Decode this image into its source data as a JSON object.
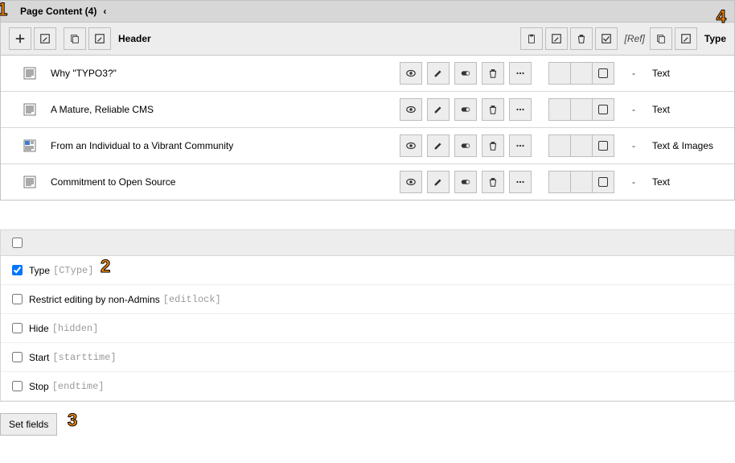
{
  "panel": {
    "title": "Page Content (4)",
    "collapse_glyph": "‹"
  },
  "columns": {
    "header": "Header",
    "ref": "[Ref]",
    "type": "Type"
  },
  "rows": [
    {
      "title": "Why \"TYPO3?\"",
      "type": "Text",
      "dash": "-",
      "icon": "text"
    },
    {
      "title": "A Mature, Reliable CMS",
      "type": "Text",
      "dash": "-",
      "icon": "text"
    },
    {
      "title": "From an Individual to a Vibrant Community",
      "type": "Text & Images",
      "dash": "-",
      "icon": "textpic"
    },
    {
      "title": "Commitment to Open Source",
      "type": "Text",
      "dash": "-",
      "icon": "text"
    }
  ],
  "fields": {
    "items": [
      {
        "label": "Type",
        "tech": "[CType]",
        "checked": true
      },
      {
        "label": "Restrict editing by non-Admins",
        "tech": "[editlock]",
        "checked": false
      },
      {
        "label": "Hide",
        "tech": "[hidden]",
        "checked": false
      },
      {
        "label": "Start",
        "tech": "[starttime]",
        "checked": false
      },
      {
        "label": "Stop",
        "tech": "[endtime]",
        "checked": false
      }
    ],
    "button": "Set fields"
  },
  "callouts": {
    "c1": "1",
    "c2": "2",
    "c3": "3",
    "c4": "4"
  }
}
